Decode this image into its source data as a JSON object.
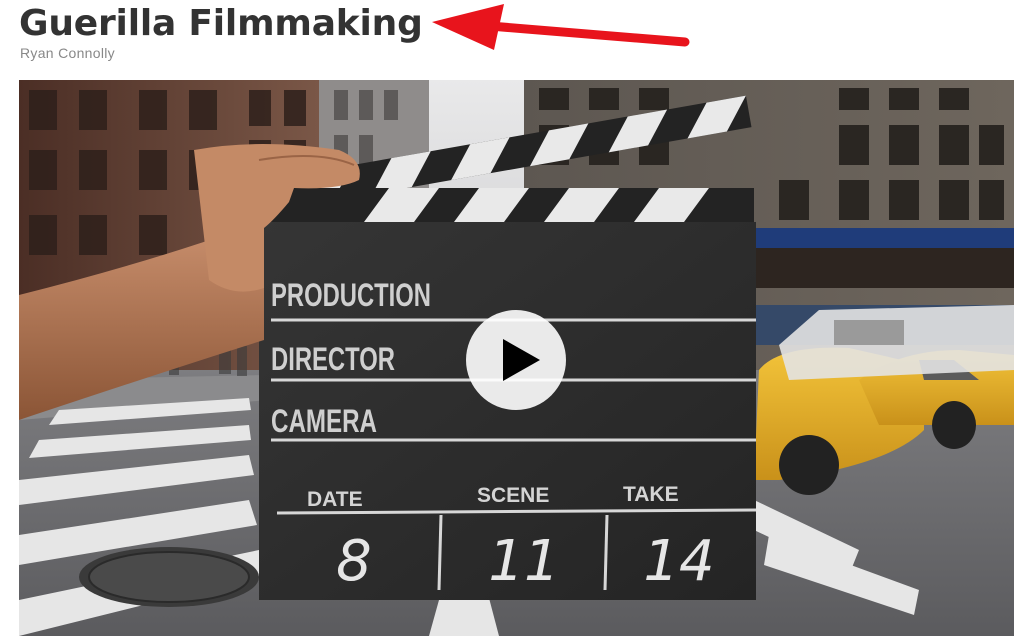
{
  "course": {
    "title": "Guerilla Filmmaking",
    "author": "Ryan Connolly"
  },
  "annotation": {
    "arrow_color": "#e8141c"
  },
  "video": {
    "play_icon": "play-icon",
    "slate": {
      "rows": [
        "PRODUCTION",
        "DIRECTOR",
        "CAMERA"
      ],
      "columns": [
        {
          "header": "DATE",
          "value": "8"
        },
        {
          "header": "SCENE",
          "value": "11"
        },
        {
          "header": "TAKE",
          "value": "14"
        }
      ]
    }
  }
}
